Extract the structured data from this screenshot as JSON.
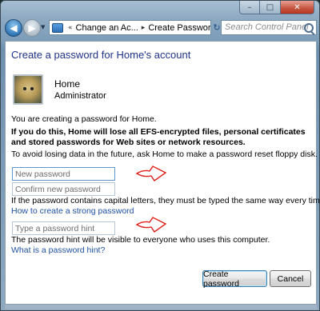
{
  "window": {
    "caption_buttons": {
      "minimize": "–",
      "maximize": "□",
      "close": "✕"
    }
  },
  "navbar": {
    "back_glyph": "◀",
    "forward_glyph": "▶",
    "breadcrumbs": [
      "Change an Ac...",
      "Create Password"
    ],
    "crumb_separator": "▸",
    "overflow_glyph": "«",
    "search_placeholder": "Search Control Panel",
    "refresh_glyph": "↻",
    "dropdown_glyph": "▼"
  },
  "page": {
    "title": "Create a password for Home's account",
    "user": {
      "name": "Home",
      "role": "Administrator"
    },
    "intro": "You are creating a password for Home.",
    "warning": "If you do this, Home will lose all EFS-encrypted files, personal certificates and stored passwords for Web sites or network resources.",
    "advice": "To avoid losing data in the future, ask Home to make a password reset floppy disk.",
    "new_password_placeholder": "New password",
    "confirm_password_placeholder": "Confirm new password",
    "case_note": "If the password contains capital letters, they must be typed the same way every time.",
    "strong_password_link": "How to create a strong password",
    "hint_placeholder": "Type a password hint",
    "hint_note": "The password hint will be visible to everyone who uses this computer.",
    "hint_help_link": "What is a password hint?",
    "create_button": "Create password",
    "cancel_button": "Cancel"
  },
  "colors": {
    "title_blue": "#1e3287",
    "link_blue": "#1e50a2",
    "annotation_red": "#e0201a"
  },
  "icons": [
    "back-arrow-icon",
    "forward-arrow-icon",
    "control-panel-icon",
    "refresh-icon",
    "search-icon",
    "user-avatar",
    "red-arrow-annotation"
  ]
}
